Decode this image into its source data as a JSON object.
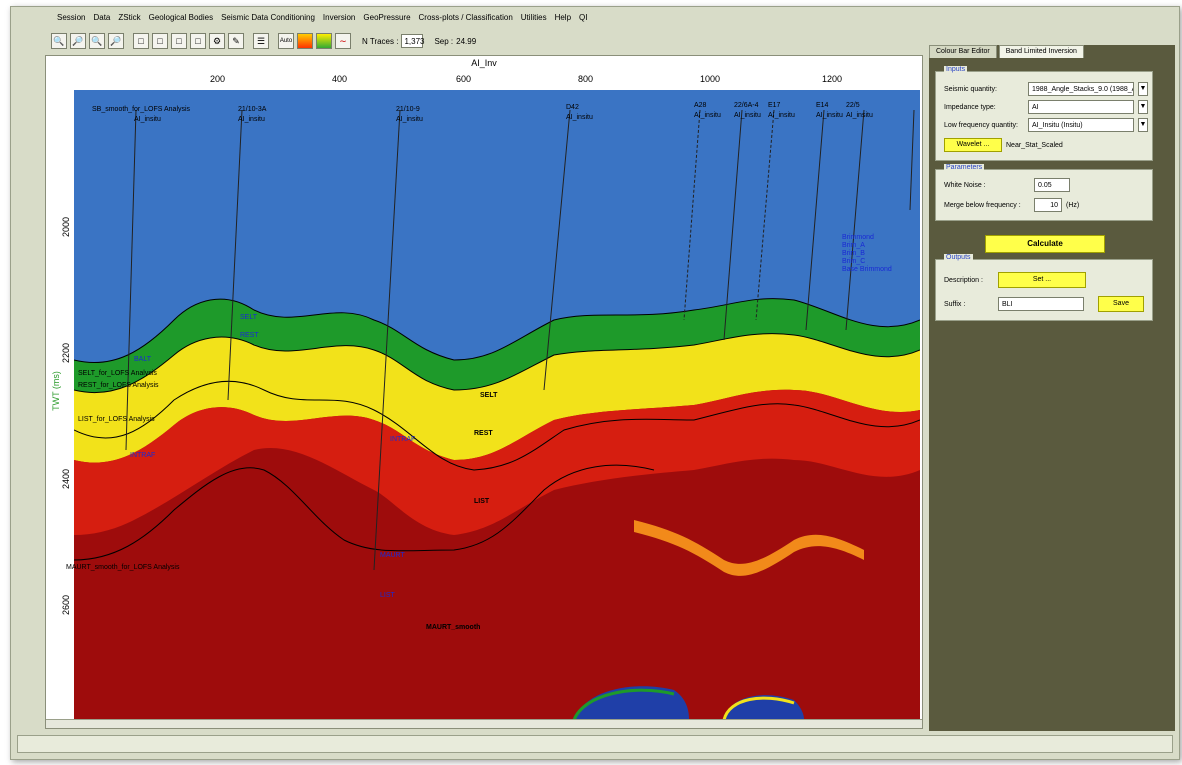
{
  "menu": [
    "Session",
    "Data",
    "ZStick",
    "Geological Bodies",
    "Seismic Data Conditioning",
    "Inversion",
    "GeoPressure",
    "Cross-plots / Classification",
    "Utilities",
    "Help",
    "QI"
  ],
  "toolbar": {
    "auto_label": "Auto",
    "n_traces_label": "N Traces :",
    "n_traces_value": "1,373",
    "sep_label": "Sep :",
    "sep_value": "24.99"
  },
  "view": {
    "title": "AI_Inv",
    "x_ticks": [
      "200",
      "400",
      "600",
      "800",
      "1000",
      "1200"
    ],
    "y_ticks": [
      "2000",
      "2200",
      "2400",
      "2600"
    ],
    "y_axis_label": "TWT (ms)",
    "well_labels": [
      "SB_smooth_for_LOFS Analysis",
      "AI_insitu",
      "21/10-3A",
      "AI_insitu",
      "21/10-9",
      "AI_insitu",
      "D42",
      "AI_insitu",
      "A28",
      "AI_insitu",
      "22/6A-4",
      "AI_insitu",
      "E17",
      "AI_insitu",
      "E14",
      "AI_insitu",
      "22/5",
      "AI_insitu"
    ],
    "horizon_labels": [
      "SELT_for_LOFS Analysis",
      "REST_for_LOFS Analysis",
      "LIST_for_LOFS Analysis",
      "INTRAF",
      "MAURT_smooth_for_LOFS Analysis",
      "SELT",
      "REST",
      "LIST",
      "MAURT_smooth",
      "BALT",
      "SELT",
      "REST",
      "INTRAF",
      "MAURT",
      "LIST",
      "Brimmond",
      "Brim_A",
      "Brim_B",
      "Brim_C",
      "Base Brimmond"
    ]
  },
  "panel": {
    "tabs": [
      "Colour Bar Editor",
      "Band Limited Inversion"
    ],
    "inputs_title": "Inputs",
    "seismic_quantity_label": "Seismic quantity:",
    "seismic_quantity_value": "1988_Angle_Stacks_9.0 (1988_A...",
    "impedance_type_label": "Impedance type:",
    "impedance_type_value": "AI",
    "low_freq_label": "Low frequency quantity:",
    "low_freq_value": "AI_Insitu (Insitu)",
    "wavelet_button": "Wavelet ...",
    "wavelet_value": "Near_Stat_Scaled",
    "parameters_title": "Parameters",
    "white_noise_label": "White Noise :",
    "white_noise_value": "0.05",
    "merge_label": "Merge below frequency :",
    "merge_value": "10",
    "merge_unit": "(Hz)",
    "calculate_button": "Calculate",
    "outputs_title": "Outputs",
    "description_label": "Description :",
    "description_button": "Set ...",
    "suffix_label": "Suffix :",
    "suffix_value": "BLI",
    "save_button": "Save"
  },
  "colors": {
    "deep_blue": "#1f3fa8",
    "light_blue": "#4fb8e8",
    "green": "#1e9a2a",
    "yellow": "#f2e21a",
    "red": "#d61e10",
    "dark_red": "#9e0c0c",
    "accent_yellow": "#ffff4a"
  }
}
